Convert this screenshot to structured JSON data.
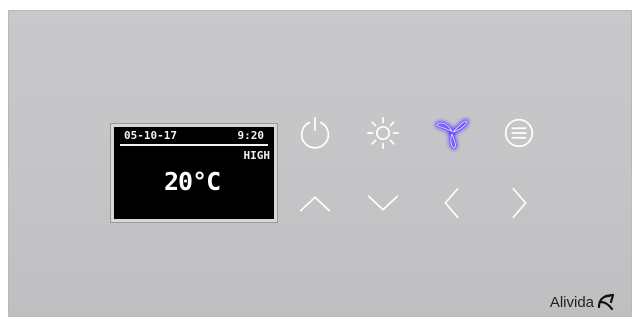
{
  "display": {
    "date": "05-10-17",
    "time": "9:20",
    "mode": "HIGH",
    "temperature": "20°C"
  },
  "buttons": {
    "power": "power-icon",
    "light": "sun-icon",
    "fan": "fan-icon",
    "menu": "menu-icon",
    "up": "chevron-up-icon",
    "down": "chevron-down-icon",
    "left": "chevron-left-icon",
    "right": "chevron-right-icon"
  },
  "active_button": "fan",
  "colors": {
    "panel": "#c6c6c8",
    "icon": "#ffffff",
    "active_glow": "#5b3dff"
  },
  "brand": {
    "name": "Alivida"
  }
}
